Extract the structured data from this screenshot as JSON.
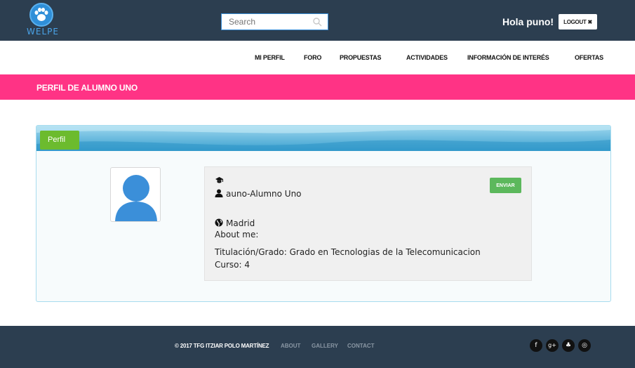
{
  "header": {
    "logo_text": "WELPE",
    "search_placeholder": "Search",
    "greeting": "Hola puno!",
    "logout_label": "LOGOUT ✖"
  },
  "nav": {
    "items": [
      {
        "label": "MI PERFIL"
      },
      {
        "label": "FORO"
      },
      {
        "label": "PROPUESTAS"
      },
      {
        "label": "ACTIVIDADES"
      },
      {
        "label": "INFORMACIÓN DE INTERÉS"
      },
      {
        "label": "OFERTAS"
      }
    ]
  },
  "page": {
    "title": "PERFIL DE ALUMNO UNO"
  },
  "profile": {
    "tab_label": "Perfil",
    "send_label": "ENVIAR",
    "username_line": "auno-Alumno Uno",
    "location": "Madrid",
    "about_me": "About me:",
    "degree_line": "Titulación/Grado: Grado en Tecnologias de la Telecomunicacion",
    "course_line": "Curso: 4"
  },
  "footer": {
    "copyright": "© 2017 TFG ITZIAR POLO MARTÍNEZ",
    "links": [
      {
        "label": "ABOUT"
      },
      {
        "label": "GALLERY"
      },
      {
        "label": "CONTACT"
      }
    ],
    "social": [
      {
        "glyph": "f",
        "icon": "facebook-icon"
      },
      {
        "glyph": "g+",
        "icon": "google-plus-icon"
      },
      {
        "glyph": "♣",
        "icon": "twitter-icon"
      },
      {
        "glyph": "◎",
        "icon": "dribbble-icon"
      }
    ]
  },
  "colors": {
    "header_bg": "#2c3e50",
    "accent_pink": "#ff3385",
    "tab_green": "#6cbb2e",
    "button_green": "#5cb85c",
    "avatar_blue": "#3b8fd9"
  }
}
